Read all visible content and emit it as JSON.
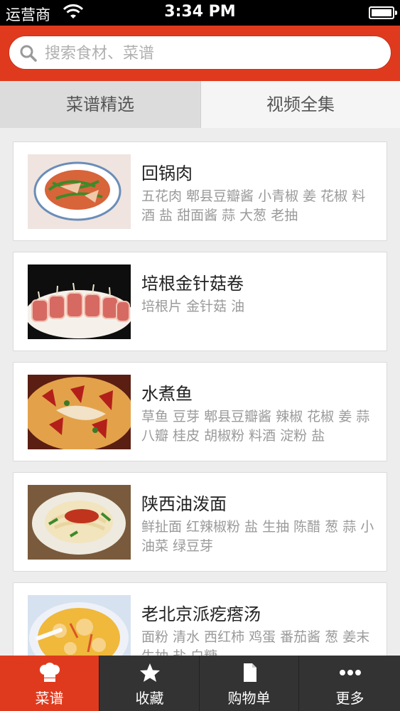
{
  "status_bar": {
    "carrier": "运营商",
    "time": "3:34 PM"
  },
  "search": {
    "placeholder": "搜索食材、菜谱"
  },
  "tabs": [
    {
      "label": "菜谱精选",
      "active": true
    },
    {
      "label": "视频全集",
      "active": false
    }
  ],
  "recipes": [
    {
      "title": "回锅肉",
      "ingredients": "五花肉 郫县豆瓣酱 小青椒 姜 花椒 料酒 盐 甜面酱 蒜 大葱 老抽"
    },
    {
      "title": "培根金针菇卷",
      "ingredients": "培根片 金针菇 油"
    },
    {
      "title": "水煮鱼",
      "ingredients": "草鱼 豆芽 郫县豆瓣酱 辣椒 花椒 姜 蒜 八瓣 桂皮 胡椒粉 料酒 淀粉 盐"
    },
    {
      "title": "陕西油泼面",
      "ingredients": "鲜扯面 红辣椒粉 盐 生抽 陈醋 葱 蒜 小油菜 绿豆芽"
    },
    {
      "title": "老北京派疙瘩汤",
      "ingredients": "面粉 清水 西红柿 鸡蛋 番茄酱 葱 姜末 生抽 盐 白糖"
    }
  ],
  "tab_bar": [
    {
      "label": "菜谱",
      "icon": "chef-hat-icon",
      "active": true
    },
    {
      "label": "收藏",
      "icon": "star-icon",
      "active": false
    },
    {
      "label": "购物单",
      "icon": "document-icon",
      "active": false
    },
    {
      "label": "更多",
      "icon": "more-dots-icon",
      "active": false
    }
  ],
  "colors": {
    "brand_red": "#e03a1e",
    "tab_bar_dark": "#333333"
  }
}
